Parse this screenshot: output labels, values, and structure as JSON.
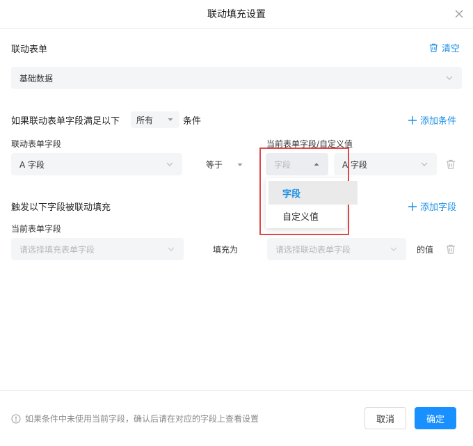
{
  "dialog": {
    "title": "联动填充设置",
    "close_icon": "close-icon"
  },
  "linked_form": {
    "label": "联动表单",
    "clear_label": "清空",
    "selected_value": "基础数据"
  },
  "condition": {
    "prefix": "如果联动表单字段满足以下",
    "match_value": "所有",
    "suffix": "条件",
    "add_label": "添加条件",
    "left_label": "联动表单字段",
    "right_label": "当前表单字段/自定义值",
    "field_value": "A 字段",
    "operator": "等于",
    "type_value": "字段",
    "target_value": "A 字段"
  },
  "type_dropdown": {
    "options": [
      "字段",
      "自定义值"
    ],
    "selected_index": 0
  },
  "fill": {
    "label": "触发以下字段被联动填充",
    "add_label": "添加字段",
    "left_label": "当前表单字段",
    "left_placeholder": "请选择填充表单字段",
    "middle_text": "填充为",
    "right_placeholder": "请选择联动表单字段",
    "suffix": "的值"
  },
  "footer": {
    "note": "如果条件中未使用当前字段，确认后请在对应的字段上查看设置",
    "cancel_label": "取消",
    "ok_label": "确定"
  },
  "colors": {
    "accent": "#1890ff",
    "link": "#1a8fe6",
    "highlight_border": "#e04848"
  }
}
